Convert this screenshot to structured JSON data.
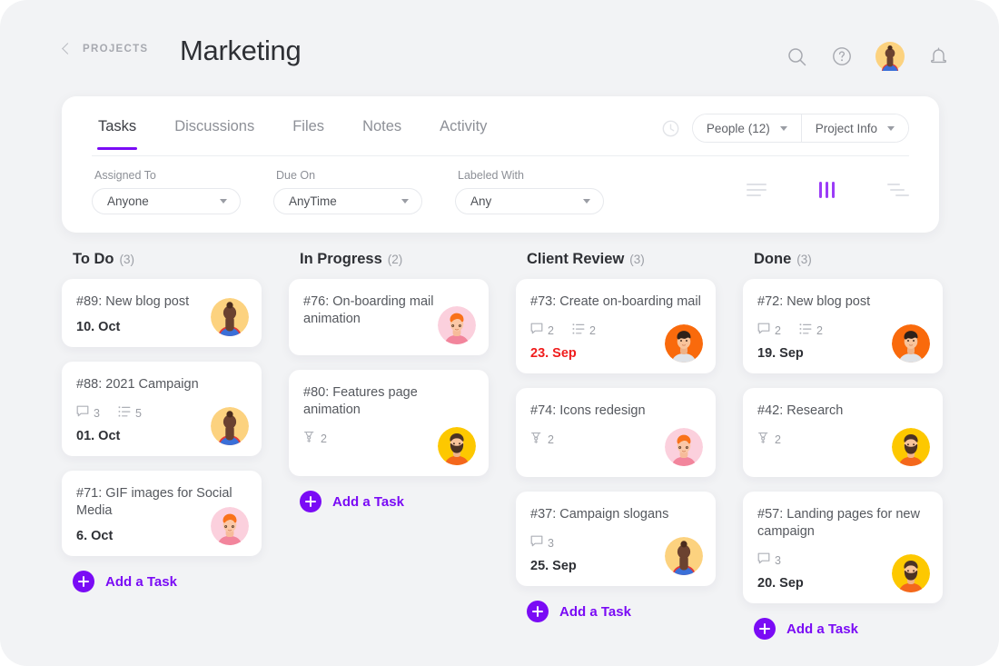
{
  "header": {
    "back_label": "PROJECTS",
    "back_icon": "chevron-left-icon",
    "title": "Marketing",
    "icons": [
      "search-icon",
      "help-circle-icon",
      "avatar",
      "bell-icon"
    ]
  },
  "panel": {
    "tabs": [
      {
        "label": "Tasks",
        "active": true
      },
      {
        "label": "Discussions",
        "active": false
      },
      {
        "label": "Files",
        "active": false
      },
      {
        "label": "Notes",
        "active": false
      },
      {
        "label": "Activity",
        "active": false
      }
    ],
    "clock_icon": "clock-icon",
    "pills": [
      {
        "label": "People (12)"
      },
      {
        "label": "Project Info"
      }
    ],
    "filters": [
      {
        "label": "Assigned To",
        "value": "Anyone"
      },
      {
        "label": "Due On",
        "value": "AnyTime"
      },
      {
        "label": "Labeled With",
        "value": "Any"
      }
    ],
    "views": [
      {
        "name": "list-view-icon",
        "active": false
      },
      {
        "name": "board-view-icon",
        "active": true
      },
      {
        "name": "sort-view-icon",
        "active": false
      }
    ]
  },
  "accent": "#7a0bf5",
  "overdue_color": "#f01d1d",
  "add_task_label": "Add a Task",
  "columns": [
    {
      "name": "To Do",
      "count": "(3)",
      "cards": [
        {
          "title": "#89: New blog post",
          "comments": null,
          "checklist": null,
          "attachments": null,
          "date": "10. Oct",
          "overdue": false,
          "avatar": "woman-bun"
        },
        {
          "title": "#88: 2021 Campaign",
          "comments": "3",
          "checklist": "5",
          "attachments": null,
          "date": "01. Oct",
          "overdue": false,
          "avatar": "woman-bun"
        },
        {
          "title": "#71: GIF images for Social Media",
          "comments": null,
          "checklist": null,
          "attachments": null,
          "date": "6. Oct",
          "overdue": false,
          "avatar": "ginger-pink"
        }
      ]
    },
    {
      "name": "In Progress",
      "count": "(2)",
      "cards": [
        {
          "title": "#76: On-boarding mail animation",
          "comments": null,
          "checklist": null,
          "attachments": null,
          "date": null,
          "overdue": false,
          "avatar": "ginger-pink"
        },
        {
          "title": "#80: Features page animation",
          "comments": null,
          "checklist": null,
          "attachments": "2",
          "date": null,
          "overdue": false,
          "avatar": "beard-yellow"
        }
      ]
    },
    {
      "name": "Client Review",
      "count": "(3)",
      "cards": [
        {
          "title": "#73: Create on-boarding mail",
          "comments": "2",
          "checklist": "2",
          "attachments": null,
          "date": "23. Sep",
          "overdue": true,
          "avatar": "man-orange"
        },
        {
          "title": "#74: Icons redesign",
          "comments": null,
          "checklist": null,
          "attachments": "2",
          "date": null,
          "overdue": false,
          "avatar": "ginger-pink"
        },
        {
          "title": "#37: Campaign slogans",
          "comments": "3",
          "checklist": null,
          "attachments": null,
          "date": "25. Sep",
          "overdue": false,
          "avatar": "woman-bun"
        }
      ]
    },
    {
      "name": "Done",
      "count": "(3)",
      "cards": [
        {
          "title": "#72: New blog post",
          "comments": "2",
          "checklist": "2",
          "attachments": null,
          "date": "19. Sep",
          "overdue": false,
          "avatar": "man-orange"
        },
        {
          "title": "#42: Research",
          "comments": null,
          "checklist": null,
          "attachments": "2",
          "date": null,
          "overdue": false,
          "avatar": "beard-yellow"
        },
        {
          "title": "#57: Landing pages for new campaign",
          "comments": "3",
          "checklist": null,
          "attachments": null,
          "date": "20. Sep",
          "overdue": false,
          "avatar": "beard-yellow"
        }
      ]
    }
  ]
}
